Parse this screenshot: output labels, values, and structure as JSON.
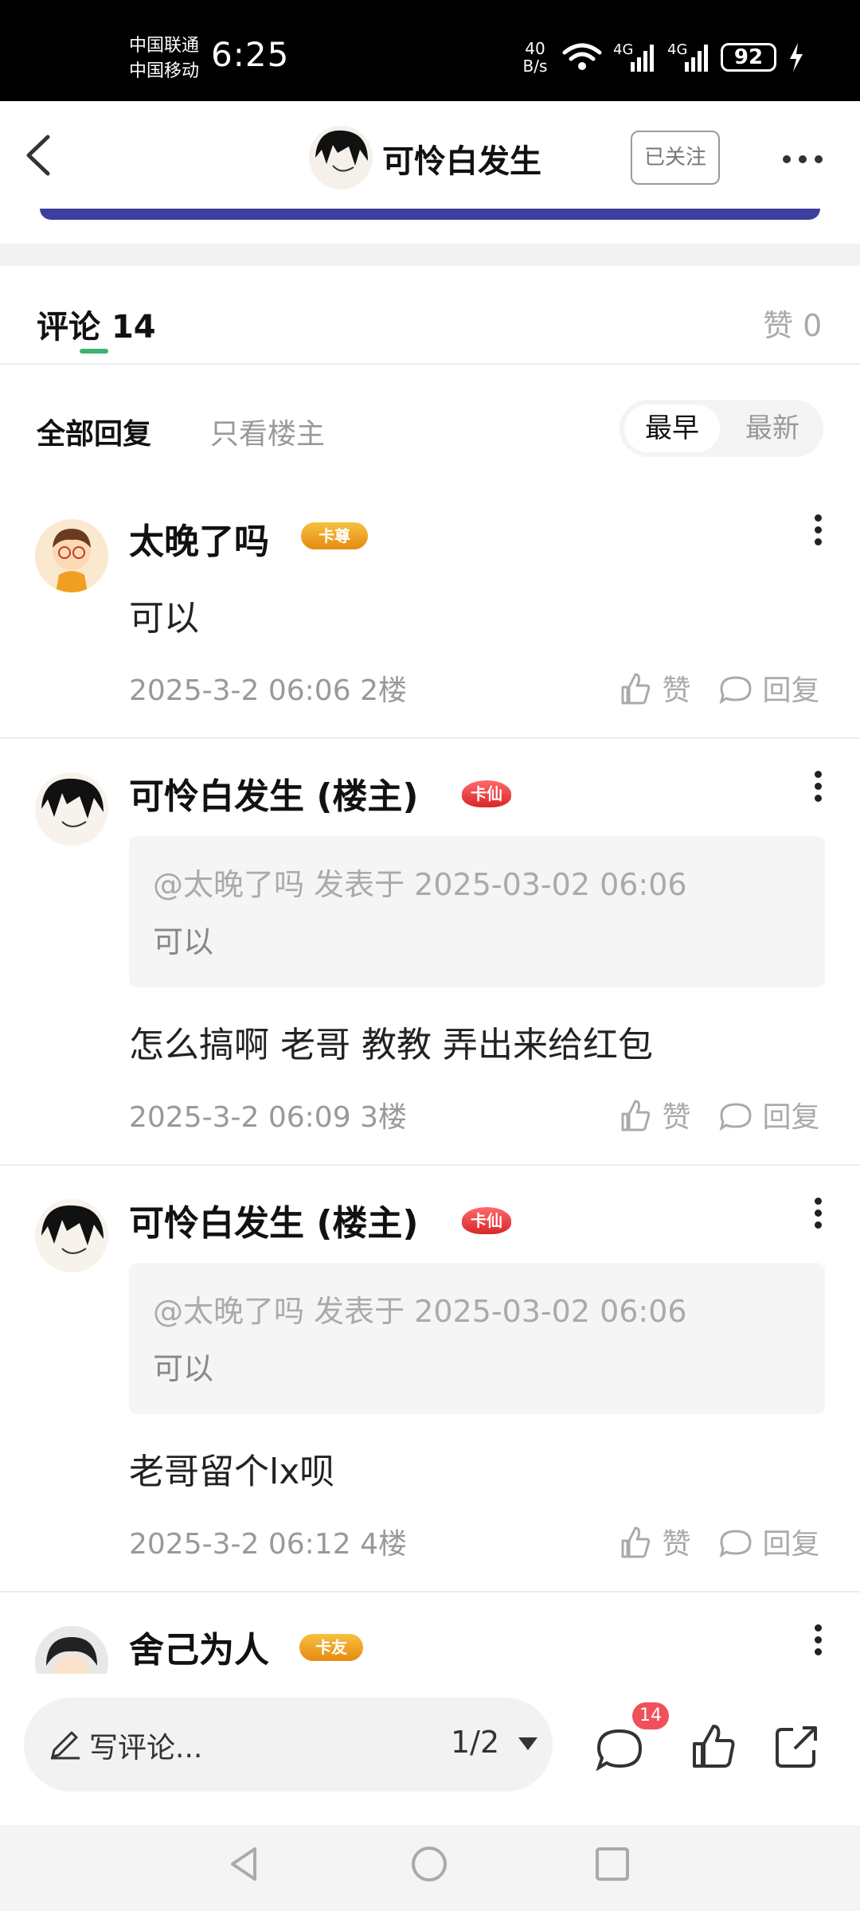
{
  "status_bar": {
    "carrier_1": "中国联通",
    "carrier_2": "中国移动",
    "time": "6:25",
    "net_speed_value": "40",
    "net_speed_unit": "B/s",
    "signal_1": "4G",
    "signal_2": "4G",
    "battery": "92"
  },
  "header": {
    "title": "可怜白发生",
    "follow_label": "已关注"
  },
  "comments_section": {
    "title": "评论",
    "count": "14",
    "likes_label": "赞 0",
    "filter_all": "全部回复",
    "filter_op": "只看楼主",
    "sort_earliest": "最早",
    "sort_latest": "最新"
  },
  "comments": [
    {
      "name": "太晚了吗",
      "badge": "卡尊",
      "text": "可以",
      "date": "2025-3-2 06:06",
      "floor": "2楼",
      "like_label": "赞",
      "reply_label": "回复"
    },
    {
      "name": "可怜白发生 (楼主)",
      "badge": "卡仙",
      "quote_header": "@太晚了吗 发表于 2025-03-02 06:06",
      "quote_text": "可以",
      "text": "怎么搞啊 老哥  教教  弄出来给红包",
      "date": "2025-3-2 06:09",
      "floor": "3楼",
      "like_label": "赞",
      "reply_label": "回复"
    },
    {
      "name": "可怜白发生 (楼主)",
      "badge": "卡仙",
      "quote_header": "@太晚了吗 发表于 2025-03-02 06:06",
      "quote_text": "可以",
      "text": "老哥留个lx呗",
      "date": "2025-3-2 06:12",
      "floor": "4楼",
      "like_label": "赞",
      "reply_label": "回复"
    },
    {
      "name": "舍己为人",
      "badge": "卡友"
    }
  ],
  "bottom_bar": {
    "write_placeholder": "写评论...",
    "page_indicator": "1/2",
    "comment_badge": "14"
  },
  "icons": {
    "back": "back-arrow-icon",
    "more": "more-dots-icon",
    "edit": "pencil-icon",
    "comment": "comment-bubble-icon",
    "like": "thumbs-up-icon",
    "share": "share-icon"
  },
  "colors": {
    "accent_green": "#3cb371",
    "badge_red": "#f0505a",
    "banner_blue": "#3b3f9e"
  }
}
